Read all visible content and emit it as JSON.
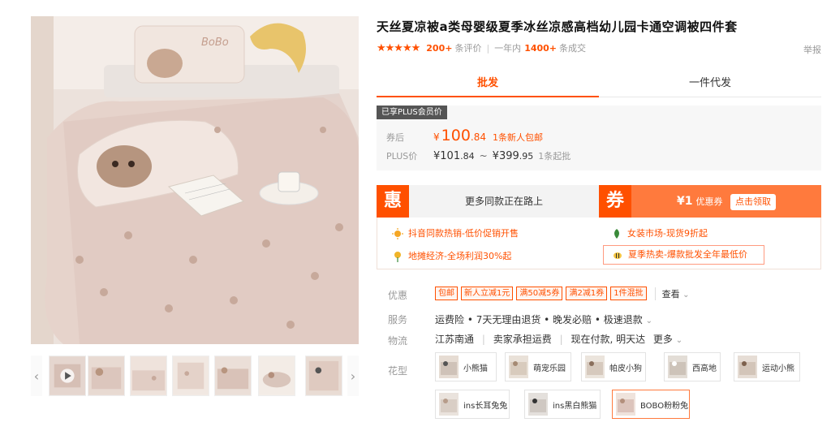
{
  "product": {
    "title": "天丝夏凉被a类母婴级夏季冰丝凉感高档幼儿园卡通空调被四件套",
    "rating_stars": "★★★★★",
    "reviews_count": "200+",
    "reviews_label": "条评价",
    "sales_period": "一年内",
    "sales_count": "1400+",
    "sales_label": "条成交",
    "report_label": "举报"
  },
  "tabs": [
    {
      "label": "批发",
      "active": true
    },
    {
      "label": "一件代发",
      "active": false
    }
  ],
  "price": {
    "plus_badge": "已享PLUS会员价",
    "after_coupon_label": "券后",
    "currency": "¥",
    "price_int": "100",
    "price_dec": ".84",
    "after_coupon_note": "1条新人包邮",
    "plus_label": "PLUS价",
    "range_low_int": "101",
    "range_low_dec": ".84",
    "range_tilde": "~",
    "range_high_int": "399",
    "range_high_dec": ".95",
    "min_order": "1条起批"
  },
  "promo": {
    "hui_icon": "惠",
    "hui_text": "更多同款正在路上",
    "quan_icon": "券",
    "coupon_amount": "¥1",
    "coupon_label": "优惠券",
    "coupon_button": "点击领取",
    "colors": {
      "accent": "#ff5000",
      "coupon_bg": "#ff7a3d"
    }
  },
  "activities": [
    {
      "icon": "sun-icon",
      "text": "抖音同款热销-低价促销开售"
    },
    {
      "icon": "leaf-icon",
      "text": "女装市场-现货9折起"
    },
    {
      "icon": "flower-icon",
      "text": "地摊经济-全场利润30%起"
    },
    {
      "icon": "bee-icon",
      "text": "夏季热卖-爆款批发全年最低价"
    }
  ],
  "discounts": {
    "label": "优惠",
    "tags": [
      "包邮",
      "新人立减1元",
      "满50减5券",
      "满2减1券",
      "1件混批"
    ],
    "view_more": "查看"
  },
  "service": {
    "label": "服务",
    "text": "运费险 • 7天无理由退货 • 晚发必赔 • 极速退款"
  },
  "logistics": {
    "label": "物流",
    "origin": "江苏南通",
    "shipping": "卖家承担运费",
    "eta": "现在付款, 明天达",
    "more": "更多"
  },
  "pattern": {
    "label": "花型",
    "options": [
      {
        "label": "小熊猫",
        "selected": false
      },
      {
        "label": "萌宠乐园",
        "selected": false
      },
      {
        "label": "帕皮小狗",
        "selected": false
      },
      {
        "label": "西高地",
        "selected": false
      },
      {
        "label": "运动小熊",
        "selected": false
      },
      {
        "label": "ins长耳兔兔",
        "selected": false
      },
      {
        "label": "ins黑白熊猫",
        "selected": false
      },
      {
        "label": "BOBO粉粉兔",
        "selected": true
      }
    ]
  },
  "gallery": {
    "pillow_text": "BoBo",
    "thumb_count": 7
  }
}
